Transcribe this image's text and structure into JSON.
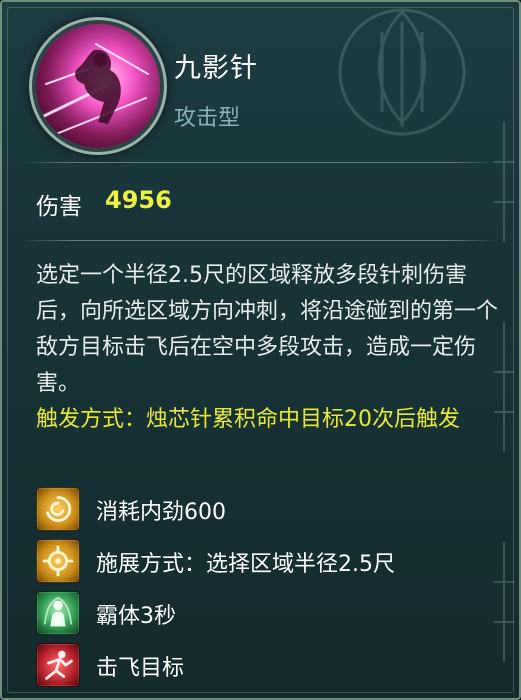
{
  "skill": {
    "name": "九影针",
    "type": "攻击型",
    "icon": "pink-slash-skill-icon"
  },
  "damage": {
    "label": "伤害",
    "value": "4956"
  },
  "description": "选定一个半径2.5尺的区域释放多段针刺伤害后，向所选区域方向冲刺，将沿途碰到的第一个敌方目标击飞后在空中多段攻击，造成一定伤害。",
  "trigger": "触发方式：烛芯针累积命中目标20次后触发",
  "attributes": [
    {
      "icon": "swirl-energy-icon",
      "text": "消耗内劲600",
      "color": "#c98a16"
    },
    {
      "icon": "target-reticle-icon",
      "text": "施展方式：选择区域半径2.5尺",
      "color": "#c98a16"
    },
    {
      "icon": "green-figure-aura-icon",
      "text": "霸体3秒",
      "color": "#2f9a52"
    },
    {
      "icon": "knockback-figure-icon",
      "text": "击飞目标",
      "color": "#b3202a"
    }
  ],
  "colors": {
    "panel_bg": "#193539",
    "damage_value": "#eef044",
    "trigger_text": "#e8e83a",
    "type_text": "#86b3b6"
  }
}
